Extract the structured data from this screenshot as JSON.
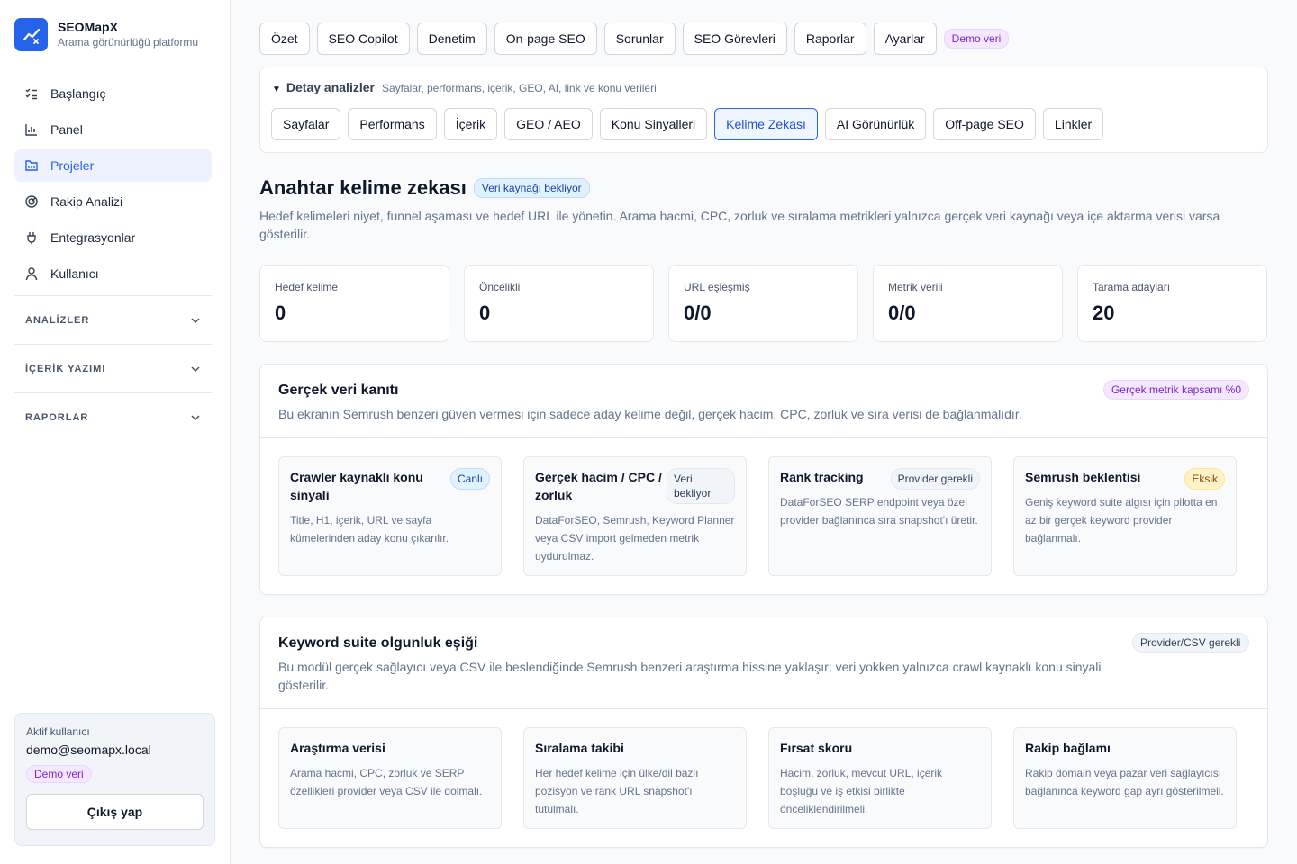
{
  "brand": {
    "name": "SEOMapX",
    "tagline": "Arama görünürlüğü platformu"
  },
  "sidebar": {
    "items": [
      {
        "label": "Başlangıç",
        "icon": "checklist-icon"
      },
      {
        "label": "Panel",
        "icon": "bar-chart-icon"
      },
      {
        "label": "Projeler",
        "icon": "folder-icon",
        "active": true
      },
      {
        "label": "Rakip Analizi",
        "icon": "radar-icon"
      },
      {
        "label": "Entegrasyonlar",
        "icon": "plug-icon"
      },
      {
        "label": "Kullanıcı",
        "icon": "user-icon"
      }
    ],
    "sections": [
      {
        "label": "ANALİZLER"
      },
      {
        "label": "İÇERİK YAZIMI"
      },
      {
        "label": "RAPORLAR"
      }
    ],
    "user": {
      "label": "Aktif kullanıcı",
      "email": "demo@seomapx.local",
      "badge": "Demo veri",
      "logout": "Çıkış yap"
    }
  },
  "tabs": [
    "Özet",
    "SEO Copilot",
    "Denetim",
    "On-page SEO",
    "Sorunlar",
    "SEO Görevleri",
    "Raporlar",
    "Ayarlar"
  ],
  "tabs_badge": "Demo veri",
  "detail": {
    "title": "Detay analizler",
    "subtitle": "Sayfalar, performans, içerik, GEO, AI, link ve konu verileri",
    "tabs": [
      "Sayfalar",
      "Performans",
      "İçerik",
      "GEO / AEO",
      "Konu Sinyalleri",
      "Kelime Zekası",
      "AI Görünürlük",
      "Off-page SEO",
      "Linkler"
    ],
    "active": "Kelime Zekası"
  },
  "page": {
    "title": "Anahtar kelime zekası",
    "status": "Veri kaynağı bekliyor",
    "description": "Hedef kelimeleri niyet, funnel aşaması ve hedef URL ile yönetin. Arama hacmi, CPC, zorluk ve sıralama metrikleri yalnızca gerçek veri kaynağı veya içe aktarma verisi varsa gösterilir."
  },
  "stats": [
    {
      "label": "Hedef kelime",
      "value": "0"
    },
    {
      "label": "Öncelikli",
      "value": "0"
    },
    {
      "label": "URL eşleşmiş",
      "value": "0/0"
    },
    {
      "label": "Metrik verili",
      "value": "0/0"
    },
    {
      "label": "Tarama adayları",
      "value": "20"
    }
  ],
  "evidence": {
    "title": "Gerçek veri kanıtı",
    "badge": "Gerçek metrik kapsamı %0",
    "description": "Bu ekranın Semrush benzeri güven vermesi için sadece aday kelime değil, gerçek hacim, CPC, zorluk ve sıra verisi de bağlanmalıdır.",
    "cards": [
      {
        "title": "Crawler kaynaklı konu sinyali",
        "badge": "Canlı",
        "text": "Title, H1, içerik, URL ve sayfa kümelerinden aday konu çıkarılır."
      },
      {
        "title": "Gerçek hacim / CPC / zorluk",
        "badge": "Veri bekliyor",
        "text": "DataForSEO, Semrush, Keyword Planner veya CSV import gelmeden metrik uydurulmaz."
      },
      {
        "title": "Rank tracking",
        "badge": "Provider gerekli",
        "text": "DataForSEO SERP endpoint veya özel provider bağlanınca sıra snapshot'ı üretir."
      },
      {
        "title": "Semrush beklentisi",
        "badge": "Eksik",
        "text": "Geniş keyword suite algısı için pilotta en az bir gerçek keyword provider bağlanmalı."
      }
    ]
  },
  "maturity": {
    "title": "Keyword suite olgunluk eşiği",
    "badge": "Provider/CSV gerekli",
    "description": "Bu modül gerçek sağlayıcı veya CSV ile beslendiğinde Semrush benzeri araştırma hissine yaklaşır; veri yokken yalnızca crawl kaynaklı konu sinyali gösterilir.",
    "cards": [
      {
        "title": "Araştırma verisi",
        "text": "Arama hacmi, CPC, zorluk ve SERP özellikleri provider veya CSV ile dolmalı."
      },
      {
        "title": "Sıralama takibi",
        "text": "Her hedef kelime için ülke/dil bazlı pozisyon ve rank URL snapshot'ı tutulmalı."
      },
      {
        "title": "Fırsat skoru",
        "text": "Hacim, zorluk, mevcut URL, içerik boşluğu ve iş etkisi birlikte önceliklendirilmeli."
      },
      {
        "title": "Rakip bağlamı",
        "text": "Rakip domain veya pazar veri sağlayıcısı bağlanınca keyword gap ayrı gösterilmeli."
      }
    ]
  },
  "colors": {
    "accent": "#2563eb",
    "text": "#0f172a",
    "muted": "#64748b",
    "border": "#e5e7eb"
  }
}
